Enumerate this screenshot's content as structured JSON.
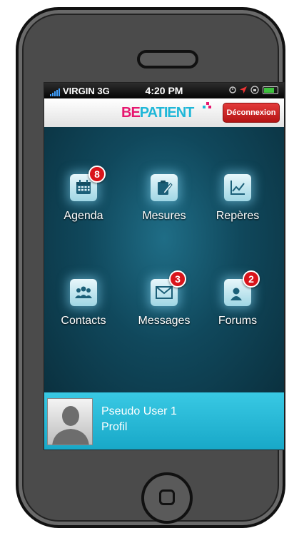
{
  "status_bar": {
    "carrier": "VIRGIN 3G",
    "time": "4:20 PM"
  },
  "header": {
    "logo_part1": "BE",
    "logo_part2": "PATIENT",
    "logout_label": "Déconnexion"
  },
  "tiles": [
    {
      "label": "Agenda",
      "icon": "calendar-icon",
      "badge": "8"
    },
    {
      "label": "Mesures",
      "icon": "notepad-icon",
      "badge": ""
    },
    {
      "label": "Repères",
      "icon": "chart-icon",
      "badge": ""
    },
    {
      "label": "Contacts",
      "icon": "people-icon",
      "badge": ""
    },
    {
      "label": "Messages",
      "icon": "envelope-icon",
      "badge": "3"
    },
    {
      "label": "Forums",
      "icon": "chat-icon",
      "badge": "2"
    }
  ],
  "profile": {
    "name": "Pseudo User 1",
    "link_label": "Profil"
  },
  "colors": {
    "badge": "#d9141b",
    "logo_magenta": "#e6176f",
    "logo_cyan": "#1fb7d8",
    "profile_bar": "#2bb9d6",
    "logout_button": "#cc2222"
  }
}
